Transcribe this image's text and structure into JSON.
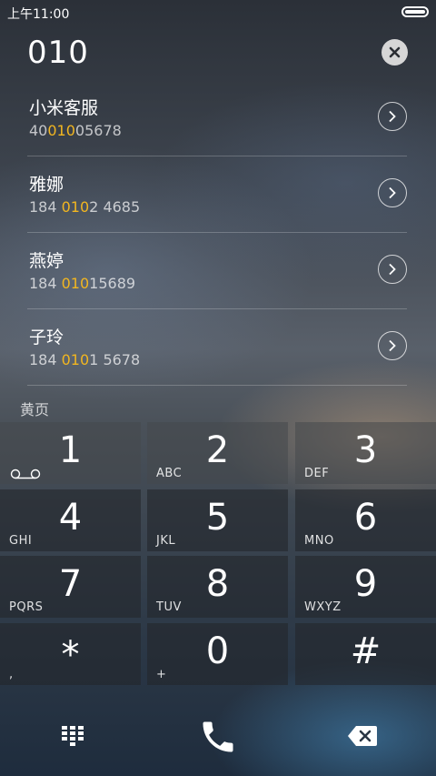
{
  "status_bar": {
    "time": "上午11:00"
  },
  "dial": {
    "number": "010"
  },
  "results": [
    {
      "name": "小米客服",
      "num_pre": "40",
      "num_match": "010",
      "num_post": "05678"
    },
    {
      "name": "雅娜",
      "num_pre": "184 ",
      "num_match": "010",
      "num_post": "2 4685"
    },
    {
      "name": "燕婷",
      "num_pre": "184 ",
      "num_match": "010",
      "num_post": "15689"
    },
    {
      "name": "子玲",
      "num_pre": "184 ",
      "num_match": "010",
      "num_post": "1 5678"
    }
  ],
  "section": {
    "label": "黄页"
  },
  "keypad": [
    {
      "digit": "1",
      "letters": ""
    },
    {
      "digit": "2",
      "letters": "ABC"
    },
    {
      "digit": "3",
      "letters": "DEF"
    },
    {
      "digit": "4",
      "letters": "GHI"
    },
    {
      "digit": "5",
      "letters": "JKL"
    },
    {
      "digit": "6",
      "letters": "MNO"
    },
    {
      "digit": "7",
      "letters": "PQRS"
    },
    {
      "digit": "8",
      "letters": "TUV"
    },
    {
      "digit": "9",
      "letters": "WXYZ"
    },
    {
      "digit": "*",
      "letters": ","
    },
    {
      "digit": "0",
      "letters": "+"
    },
    {
      "digit": "#",
      "letters": ""
    }
  ],
  "colors": {
    "highlight": "#f2b620"
  },
  "icons": {
    "battery": "battery-icon",
    "clear": "close-icon",
    "detail": "chevron-right-icon",
    "voicemail": "voicemail-icon",
    "dialpad": "dialpad-icon",
    "call": "phone-icon",
    "backspace": "backspace-icon"
  }
}
